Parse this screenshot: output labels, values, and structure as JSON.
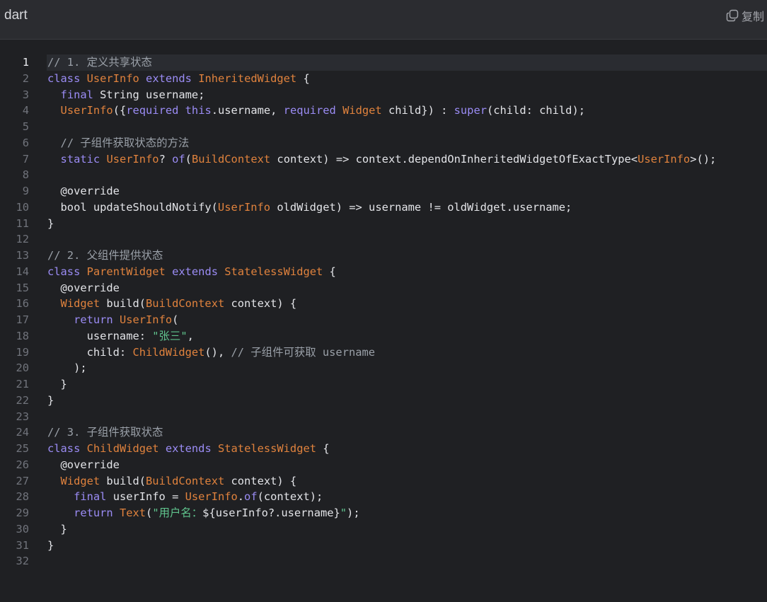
{
  "header": {
    "language": "dart",
    "copy_label": "复制",
    "copy_icon": "copy-icon"
  },
  "colors": {
    "keyword": "#9b8cf5",
    "type": "#e0823d",
    "comment": "#9aa0a8",
    "string": "#5fc28c",
    "plain": "#e3e4e8"
  },
  "editor": {
    "active_line": 1,
    "lines": [
      [
        [
          "cm",
          "// 1. 定义共享状态"
        ]
      ],
      [
        [
          "kw",
          "class"
        ],
        [
          "pl",
          " "
        ],
        [
          "ty",
          "UserInfo"
        ],
        [
          "pl",
          " "
        ],
        [
          "kw",
          "extends"
        ],
        [
          "pl",
          " "
        ],
        [
          "ty",
          "InheritedWidget"
        ],
        [
          "pl",
          " {"
        ]
      ],
      [
        [
          "pl",
          "  "
        ],
        [
          "kw",
          "final"
        ],
        [
          "pl",
          " String username;"
        ]
      ],
      [
        [
          "pl",
          "  "
        ],
        [
          "ty",
          "UserInfo"
        ],
        [
          "pl",
          "({"
        ],
        [
          "kw",
          "required"
        ],
        [
          "pl",
          " "
        ],
        [
          "kw",
          "this"
        ],
        [
          "pl",
          ".username, "
        ],
        [
          "kw",
          "required"
        ],
        [
          "pl",
          " "
        ],
        [
          "ty",
          "Widget"
        ],
        [
          "pl",
          " child}) : "
        ],
        [
          "kw",
          "super"
        ],
        [
          "pl",
          "(child: child);"
        ]
      ],
      [],
      [
        [
          "pl",
          "  "
        ],
        [
          "cm",
          "// 子组件获取状态的方法"
        ]
      ],
      [
        [
          "pl",
          "  "
        ],
        [
          "kw",
          "static"
        ],
        [
          "pl",
          " "
        ],
        [
          "ty",
          "UserInfo"
        ],
        [
          "pl",
          "? "
        ],
        [
          "kw",
          "of"
        ],
        [
          "pl",
          "("
        ],
        [
          "ty",
          "BuildContext"
        ],
        [
          "pl",
          " context) => context.dependOnInheritedWidgetOfExactType<"
        ],
        [
          "ty",
          "UserInfo"
        ],
        [
          "pl",
          ">();"
        ]
      ],
      [],
      [
        [
          "pl",
          "  @override"
        ]
      ],
      [
        [
          "pl",
          "  bool updateShouldNotify("
        ],
        [
          "ty",
          "UserInfo"
        ],
        [
          "pl",
          " oldWidget) => username != oldWidget.username;"
        ]
      ],
      [
        [
          "pl",
          "}"
        ]
      ],
      [],
      [
        [
          "cm",
          "// 2. 父组件提供状态"
        ]
      ],
      [
        [
          "kw",
          "class"
        ],
        [
          "pl",
          " "
        ],
        [
          "ty",
          "ParentWidget"
        ],
        [
          "pl",
          " "
        ],
        [
          "kw",
          "extends"
        ],
        [
          "pl",
          " "
        ],
        [
          "ty",
          "StatelessWidget"
        ],
        [
          "pl",
          " {"
        ]
      ],
      [
        [
          "pl",
          "  @override"
        ]
      ],
      [
        [
          "pl",
          "  "
        ],
        [
          "ty",
          "Widget"
        ],
        [
          "pl",
          " build("
        ],
        [
          "ty",
          "BuildContext"
        ],
        [
          "pl",
          " context) {"
        ]
      ],
      [
        [
          "pl",
          "    "
        ],
        [
          "kw",
          "return"
        ],
        [
          "pl",
          " "
        ],
        [
          "ty",
          "UserInfo"
        ],
        [
          "pl",
          "("
        ]
      ],
      [
        [
          "pl",
          "      username: "
        ],
        [
          "st",
          "\"张三\""
        ],
        [
          "pl",
          ","
        ]
      ],
      [
        [
          "pl",
          "      child: "
        ],
        [
          "ty",
          "ChildWidget"
        ],
        [
          "pl",
          "(), "
        ],
        [
          "cm",
          "// 子组件可获取 username"
        ]
      ],
      [
        [
          "pl",
          "    );"
        ]
      ],
      [
        [
          "pl",
          "  }"
        ]
      ],
      [
        [
          "pl",
          "}"
        ]
      ],
      [],
      [
        [
          "cm",
          "// 3. 子组件获取状态"
        ]
      ],
      [
        [
          "kw",
          "class"
        ],
        [
          "pl",
          " "
        ],
        [
          "ty",
          "ChildWidget"
        ],
        [
          "pl",
          " "
        ],
        [
          "kw",
          "extends"
        ],
        [
          "pl",
          " "
        ],
        [
          "ty",
          "StatelessWidget"
        ],
        [
          "pl",
          " {"
        ]
      ],
      [
        [
          "pl",
          "  @override"
        ]
      ],
      [
        [
          "pl",
          "  "
        ],
        [
          "ty",
          "Widget"
        ],
        [
          "pl",
          " build("
        ],
        [
          "ty",
          "BuildContext"
        ],
        [
          "pl",
          " context) {"
        ]
      ],
      [
        [
          "pl",
          "    "
        ],
        [
          "kw",
          "final"
        ],
        [
          "pl",
          " userInfo = "
        ],
        [
          "ty",
          "UserInfo"
        ],
        [
          "pl",
          "."
        ],
        [
          "kw",
          "of"
        ],
        [
          "pl",
          "(context);"
        ]
      ],
      [
        [
          "pl",
          "    "
        ],
        [
          "kw",
          "return"
        ],
        [
          "pl",
          " "
        ],
        [
          "ty",
          "Text"
        ],
        [
          "pl",
          "("
        ],
        [
          "st",
          "\"用户名："
        ],
        [
          "pl",
          "${userInfo?.username}"
        ],
        [
          "st",
          "\""
        ],
        [
          "pl",
          ");"
        ]
      ],
      [
        [
          "pl",
          "  }"
        ]
      ],
      [
        [
          "pl",
          "}"
        ]
      ],
      []
    ]
  }
}
